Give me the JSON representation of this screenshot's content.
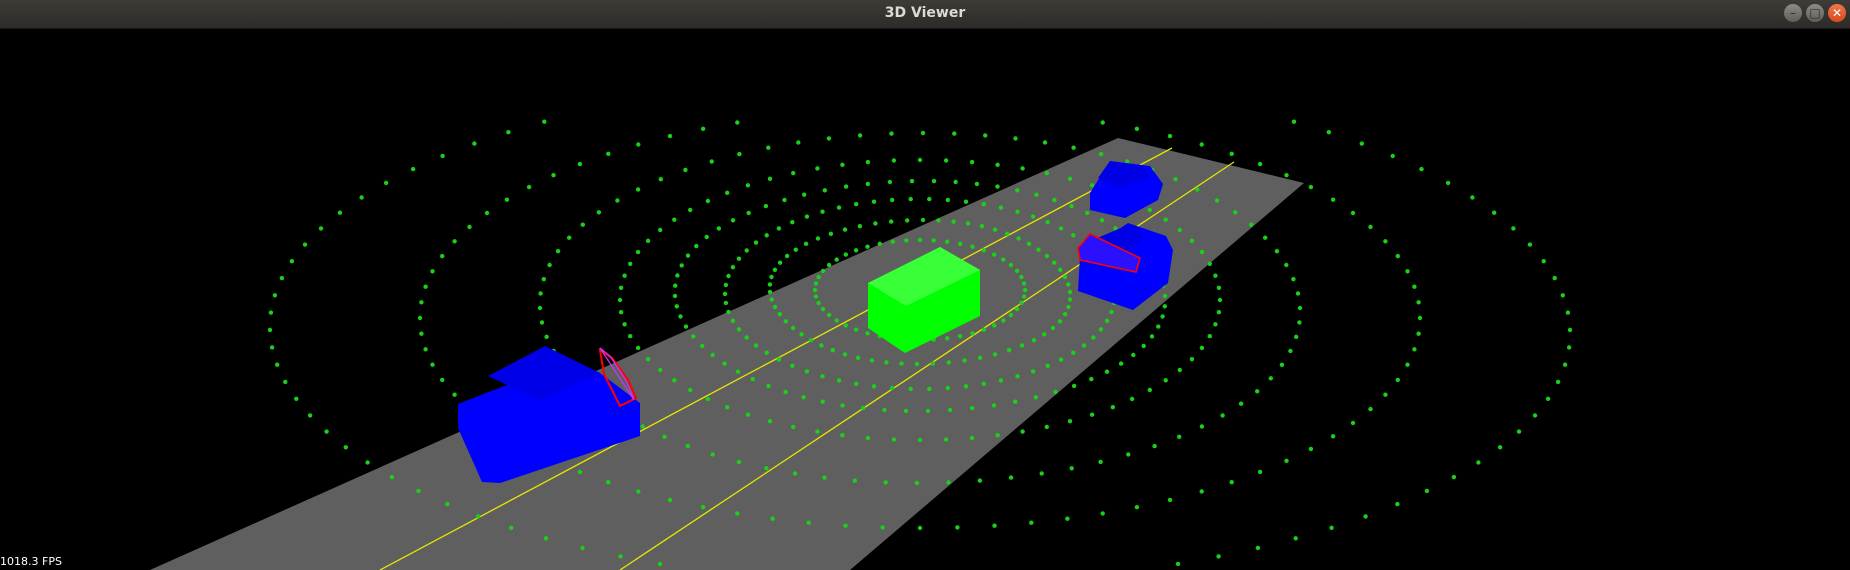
{
  "window": {
    "title": "3D Viewer",
    "controls": [
      {
        "name": "minimize",
        "glyph": "–"
      },
      {
        "name": "maximize",
        "glyph": "□"
      },
      {
        "name": "close",
        "glyph": "✕"
      }
    ]
  },
  "viewport": {
    "background_color": "#000000",
    "road_color": "#5f5f5f",
    "lane_line_color": "#e6e600",
    "ego_vehicle_color": "#00ff00",
    "vehicle_color": "#0000ff",
    "detection_box_color": "#ff0000",
    "point_cloud_color": "#19d119"
  },
  "status": {
    "fps": "1018.3 FPS"
  }
}
